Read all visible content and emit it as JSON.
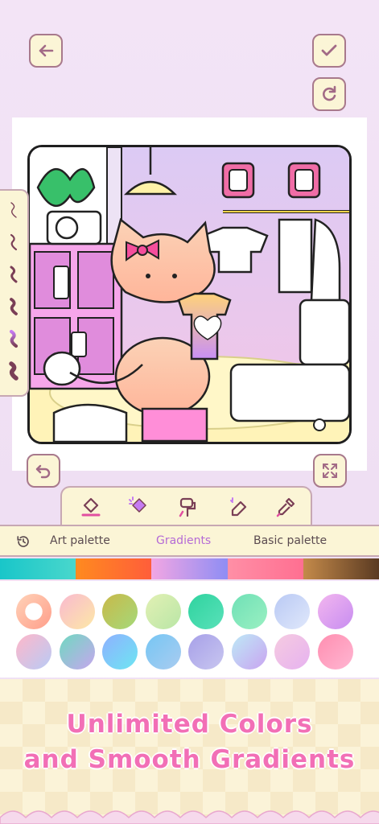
{
  "toolbar": {
    "back_icon": "arrow-left-icon",
    "confirm_icon": "check-icon",
    "reset_icon": "refresh-icon",
    "undo_icon": "undo-icon",
    "fullscreen_icon": "expand-icon"
  },
  "brushes": [
    "thin-brush-icon",
    "pencil-brush-icon",
    "marker-brush-icon",
    "ink-brush-icon",
    "gradient-brush-icon",
    "paint-brush-icon"
  ],
  "tools": [
    "bucket-fill-icon",
    "magic-fill-icon",
    "roller-icon",
    "eraser-icon",
    "eyedropper-icon"
  ],
  "palette_tabs": {
    "history_icon": "history-icon",
    "art": "Art palette",
    "gradients": "Gradients",
    "basic": "Basic palette",
    "active": "Gradients"
  },
  "gradient_strip": [
    [
      "#19c6c9",
      "#49d7cc"
    ],
    [
      "#ff8a1f",
      "#ff5e3a"
    ],
    [
      "#f2a6e3",
      "#8e8df4"
    ],
    [
      "#ff8fa6",
      "#ff6f91"
    ],
    [
      "#c48a4a",
      "#5a3a22"
    ]
  ],
  "swatches": [
    [
      "#ffffff",
      "#ffb99a"
    ],
    [
      "#f9b9d0",
      "#fde8a6"
    ],
    [
      "#c9b949",
      "#a4d97a"
    ],
    [
      "#e2f0b4",
      "#b9e6a6"
    ],
    [
      "#2fd39f",
      "#59e1b9"
    ],
    [
      "#6fe0b6",
      "#9af0c2"
    ],
    [
      "#b9c9f4",
      "#e0e8fb"
    ],
    [
      "#f3b6ef",
      "#c78df0"
    ],
    [
      "#ffb7c9",
      "#b8cbf6"
    ],
    [
      "#6fd9c0",
      "#c7a6ee"
    ],
    [
      "#8fb0ff",
      "#6de6f2"
    ],
    [
      "#76c6f4",
      "#a9ccf0"
    ],
    [
      "#a7a0e8",
      "#c8c6f0"
    ],
    [
      "#bde9f6",
      "#c9a4f1"
    ],
    [
      "#f6cbe0",
      "#e6b2f0"
    ],
    [
      "#ff8eb0",
      "#ffb6d2"
    ]
  ],
  "promo": {
    "line1": "Unlimited Colors",
    "line2": "and Smooth Gradients"
  },
  "colors": {
    "accent_pink": "#f26fb6",
    "tab_active": "#b56bd6",
    "cream": "#fbf5d6",
    "border_mauve": "#a8798c"
  }
}
